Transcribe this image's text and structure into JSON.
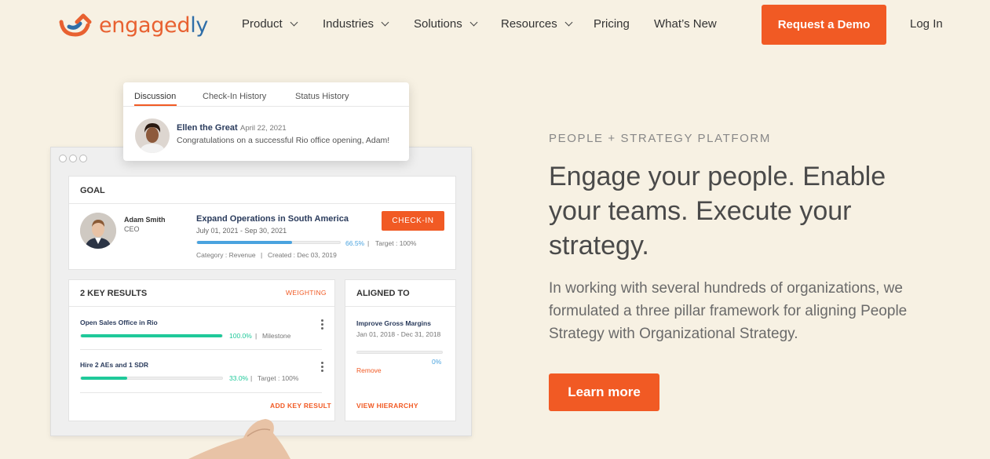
{
  "nav": {
    "logo_text_main": "engaged",
    "logo_text_tail": "ly",
    "items": [
      {
        "label": "Product",
        "dropdown": true
      },
      {
        "label": "Industries",
        "dropdown": true
      },
      {
        "label": "Solutions",
        "dropdown": true
      },
      {
        "label": "Resources",
        "dropdown": true
      },
      {
        "label": "Pricing",
        "dropdown": false
      },
      {
        "label": "What’s New",
        "dropdown": false
      }
    ],
    "demo_button": "Request a Demo",
    "login": "Log In"
  },
  "hero": {
    "eyebrow": "PEOPLE + STRATEGY PLATFORM",
    "headline": "Engage your people. Enable your teams. Execute your strategy.",
    "subtext": "In working with several hundreds of organizations, we formulated a three pillar framework for aligning People Strategy with Organizational Strategy.",
    "cta": "Learn more"
  },
  "popup": {
    "tabs": [
      "Discussion",
      "Check-In History",
      "Status History"
    ],
    "author": "Ellen the Great",
    "date": "April 22, 2021",
    "message": "Congratulations on a successful Rio office opening, Adam!"
  },
  "goal": {
    "section_title": "GOAL",
    "owner_name": "Adam Smith",
    "owner_role": "CEO",
    "title": "Expand Operations in South America",
    "dates": "July 01, 2021 - Sep 30, 2021",
    "progress": 66.5,
    "progress_label": "66.5%",
    "target_label": "Target : 100%",
    "category": "Category : Revenue",
    "created": "Created : Dec 03, 2019",
    "checkin_button": "CHECK-IN"
  },
  "key_results": {
    "section_title": "2 KEY RESULTS",
    "weighting": "WEIGHTING",
    "items": [
      {
        "title": "Open Sales Office in Rio",
        "progress": 100,
        "progress_label": "100.0%",
        "meta": "Milestone"
      },
      {
        "title": "Hire 2 AEs and 1 SDR",
        "progress": 33,
        "progress_label": "33.0%",
        "meta": "Target : 100%"
      }
    ],
    "add_link": "ADD KEY RESULT"
  },
  "aligned": {
    "section_title": "ALIGNED TO",
    "title": "Improve Gross Margins",
    "dates": "Jan 01, 2018 - Dec 31, 2018",
    "progress": 0,
    "progress_label": "0%",
    "remove": "Remove",
    "hierarchy_link": "VIEW HIERARCHY"
  },
  "colors": {
    "brand_orange": "#f15a24",
    "brand_blue": "#2f6ea8",
    "progress_blue": "#4aa3df",
    "progress_green": "#1fc99a",
    "background": "#f7f1e3"
  }
}
